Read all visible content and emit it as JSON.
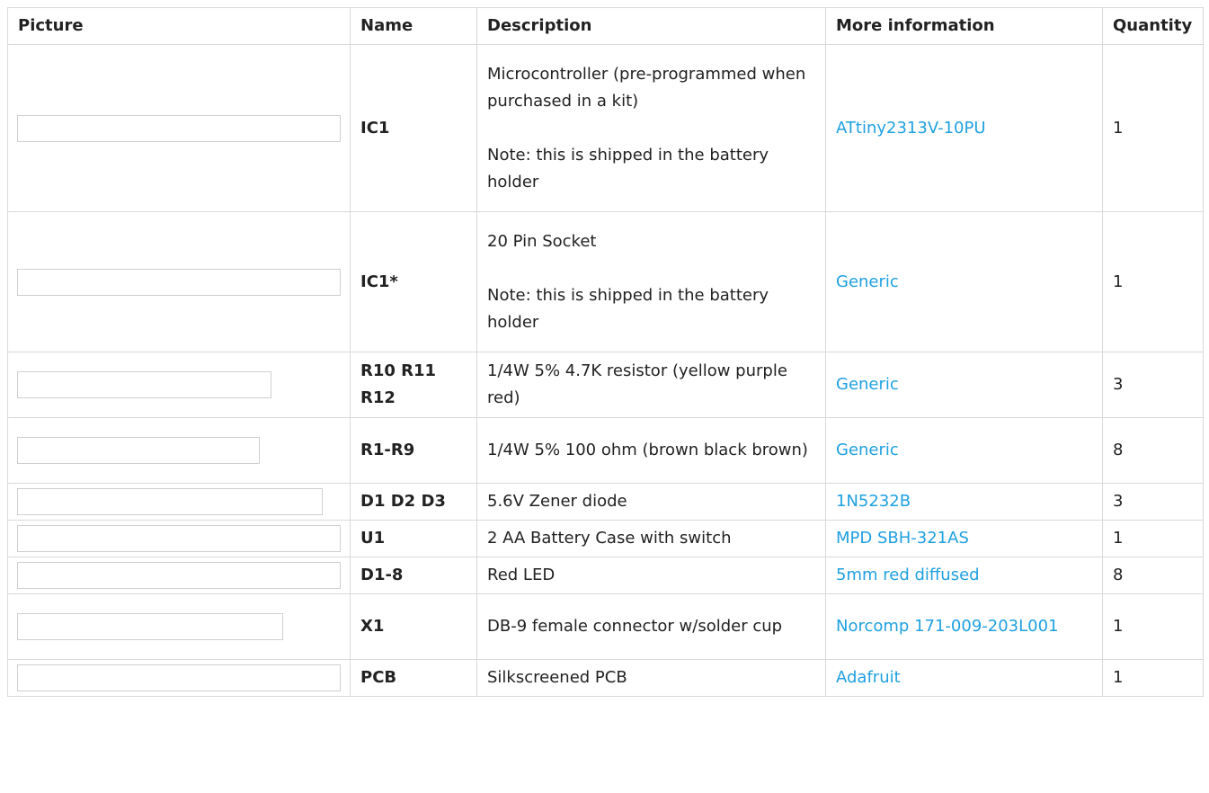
{
  "table": {
    "headers": {
      "picture": "Picture",
      "name": "Name",
      "description": "Description",
      "more_info": "More information",
      "quantity": "Quantity"
    },
    "rows": [
      {
        "name": "IC1",
        "desc_main": "Microcontroller (pre-programmed when purchased in a kit)",
        "desc_note": "Note: this is shipped in the battery holder",
        "link": "ATtiny2313V-10PU",
        "qty": "1"
      },
      {
        "name": "IC1*",
        "desc_main": "20 Pin Socket",
        "desc_note": "Note: this is shipped in the battery holder",
        "link": "Generic",
        "qty": "1"
      },
      {
        "name": "R10 R11 R12",
        "desc_main": "1/4W 5% 4.7K resistor (yellow purple red)",
        "link": "Generic",
        "qty": "3"
      },
      {
        "name": "R1-R9",
        "desc_main": "1/4W 5% 100 ohm (brown black brown)",
        "link": "Generic",
        "qty": "8"
      },
      {
        "name": "D1 D2 D3",
        "desc_main": "5.6V Zener diode",
        "link": "1N5232B",
        "qty": "3"
      },
      {
        "name": "U1",
        "desc_main": "2 AA Battery Case with switch",
        "link": "MPD SBH-321AS",
        "qty": "1"
      },
      {
        "name": "D1-8",
        "desc_main": "Red LED",
        "link": "5mm red diffused",
        "qty": "8"
      },
      {
        "name": "X1",
        "desc_main": "DB-9 female connector w/solder cup",
        "link": "Norcomp 171-009-203L001",
        "qty": "1"
      },
      {
        "name": "PCB",
        "desc_main": "Silkscreened PCB",
        "link": "Adafruit",
        "qty": "1"
      }
    ]
  }
}
